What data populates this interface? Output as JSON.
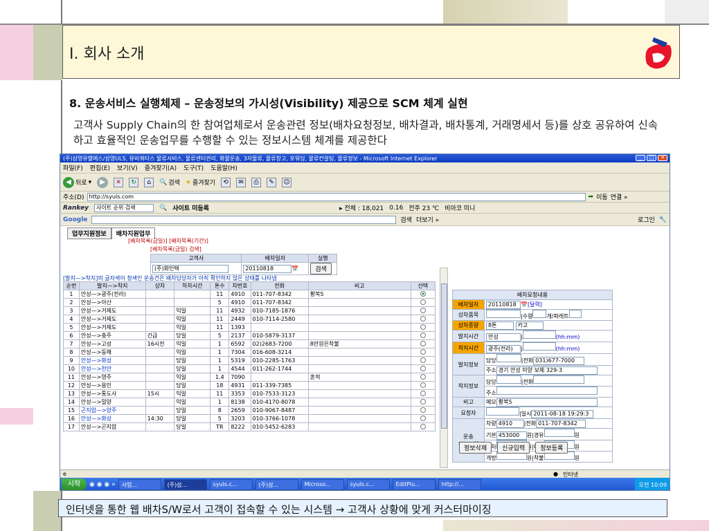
{
  "slide": {
    "title": "I. 회사 소개",
    "section_title": "8. 운송서비스 실행체제 – 운송정보의 가시성(Visibility) 제공으로 SCM 체계 실현",
    "description": "고객사 Supply Chain의 한 참여업체로서 운송관련 정보(배차요청정보, 배차결과, 배차통계, 거래명세서 등)를 상호 공유하여 신속하고 효율적인 운송업무를 수행할 수 있는 정보시스템 체계를 제공한다",
    "footer": "인터넷을 통한 웹 배차S/W로서 고객이 접속할 수 있는 시스템 → 고객사 상황에 맞게 커스터마이징"
  },
  "browser": {
    "window_title": "(주)삼영유핼에스/삼영ULS, 유비쿼터스 물류서비스, 물류센터관리, 화물운송, 3자물류, 물류창고, 포워딩, 물류컨설팅, 물류정보 - Microsoft Internet Explorer",
    "menu": [
      "파일(F)",
      "편집(E)",
      "보기(V)",
      "즐겨찾기(A)",
      "도구(T)",
      "도움말(H)"
    ],
    "toolbar": {
      "back": "뒤로",
      "search": "검색",
      "favorites": "즐겨찾기"
    },
    "address_label": "주소(D)",
    "address": "http://syuls.com",
    "go_label": "이동",
    "links_label": "연결 »",
    "rankey": {
      "brand": "Rankey",
      "site_rank": "사이트 순위 검색",
      "register": "사이트 미등록",
      "total": "▸ 전체 : 18,021",
      "rate": "0.16",
      "weather": "전주 23 ℃",
      "bio": "비아코 미니"
    },
    "google": {
      "brand": "Google",
      "search": "검색",
      "more": "더보기 »",
      "login": "로그인"
    },
    "status_internet": "인터넷"
  },
  "app": {
    "tabs": [
      "업무지원정보",
      "배차지원업무"
    ],
    "subtabs": "[배차목록(금일)]   [배차목록(기간)]",
    "search_title": "[배차목록(금일) 검색]",
    "search_headers": {
      "customer": "고객사",
      "date": "배차일자",
      "action": "실행"
    },
    "search_values": {
      "customer": "(주)화인텍",
      "date": "20110818",
      "button": "검색"
    },
    "notice": "[발지—>착지]의 글자색이 청색인 운송건은 배차담당자가 아직 확인하지 않은 상태를 나타냄",
    "list_headers": [
      "순번",
      "발지—>착지",
      "상차",
      "하차시간",
      "톤수",
      "차번호",
      "전화",
      "비고",
      "선택"
    ],
    "list_rows": [
      [
        "1",
        "안성—>광주(전라)",
        "",
        "",
        "11",
        "4910",
        "011-707-8342",
        "황복5",
        ""
      ],
      [
        "2",
        "안성—>아산",
        "",
        "",
        "5",
        "4910",
        "011-707-8342",
        "",
        ""
      ],
      [
        "3",
        "안성—>거제도",
        "",
        "익일",
        "11",
        "4932",
        "010-7185-1876",
        "",
        ""
      ],
      [
        "4",
        "안성—>거제도",
        "",
        "익일",
        "11",
        "2449",
        "010-7114-2580",
        "",
        ""
      ],
      [
        "5",
        "안성—>거제도",
        "",
        "익일",
        "11",
        "1393",
        "",
        "",
        ""
      ],
      [
        "6",
        "안성—>충주",
        "긴급",
        "당일",
        "5",
        "2137",
        "010-5879-3137",
        "",
        ""
      ],
      [
        "7",
        "안성—>고성",
        "16시전",
        "익일",
        "1",
        "6592",
        "02)2683-7200",
        "8만원은착불",
        ""
      ],
      [
        "8",
        "안성—>동해",
        "",
        "익일",
        "1",
        "7304",
        "016-608-3214",
        "",
        ""
      ],
      [
        "9",
        "안성—>화성",
        "",
        "당일",
        "1",
        "5319",
        "010-2285-1763",
        "",
        ""
      ],
      [
        "10",
        "안성—>천안",
        "",
        "당일",
        "1",
        "4544",
        "011-262-1744",
        "",
        ""
      ],
      [
        "11",
        "안성—>영주",
        "",
        "익일",
        "1.4",
        "7090",
        "",
        "혼적",
        ""
      ],
      [
        "12",
        "안성—>용인",
        "",
        "당일",
        "18",
        "4931",
        "011-339-7385",
        "",
        ""
      ],
      [
        "13",
        "안성—>통도사",
        "15시",
        "익일",
        "11",
        "3353",
        "010-7533-3123",
        "",
        ""
      ],
      [
        "14",
        "안성—>밀양",
        "",
        "익일",
        "1",
        "8138",
        "010-4170-8078",
        "",
        ""
      ],
      [
        "15",
        "곤지암—>양주",
        "",
        "당일",
        "8",
        "2659",
        "010-9067-8487",
        "",
        ""
      ],
      [
        "16",
        "안성—>화성",
        "14:30",
        "당일",
        "5",
        "3203",
        "010-3766-1078",
        "",
        ""
      ],
      [
        "17",
        "안성—>곤지암",
        "",
        "당일",
        "TR",
        "8222",
        "010-5452-6283",
        "",
        ""
      ]
    ],
    "blue_rows": [
      9,
      10,
      15,
      16
    ],
    "selected_row": 1,
    "detail": {
      "header": "배차요청내용",
      "date_label": "배차일자",
      "date_value": "20110818",
      "calendar": "[달력]",
      "goods_label": "상차품목",
      "qty_label": "수량",
      "pallet_label": "개/파레트",
      "type_label": "상차종량",
      "type_value": "8톤",
      "type_value2": "카고",
      "dep_time_label": "발지시간",
      "dep_time_value": "안성",
      "hhmm": "(hh:mm)",
      "arr_time_label": "착지시간",
      "arr_time_value": "광주(전라)",
      "dep_info_label": "발지정보",
      "manager_label": "담당",
      "tel_label": "전화",
      "dep_tel": "031)677-7000",
      "addr_label": "주소",
      "dep_addr": "경기 안성 미양 보체 329-3",
      "arr_info_label": "착지정보",
      "note_label": "비고",
      "memo_label": "메모",
      "memo_value": "황복5",
      "requester_label": "요청자",
      "datetime_label": "일시",
      "datetime_value": "2011-08-18 19:29:3",
      "car_label": "차량",
      "car_value": "4910",
      "car_tel": "011-707-8342",
      "trans_label": "운송\n정보조회",
      "base_label": "기본",
      "base_value": "453000",
      "won": "원",
      "via_label": "경유",
      "collect_label": "회차",
      "wait_label": "대기",
      "extra_label": "개방",
      "arrival_pay_label": "착불",
      "buttons": [
        "정보삭제",
        "신규입력",
        "정보등록"
      ]
    }
  },
  "taskbar": {
    "start": "시작",
    "tasks": [
      "사업...",
      "(주)삼...",
      "syuls.c...",
      "(주)삼...",
      "Microso...",
      "syuls.c...",
      "EditPlu...",
      "http://..."
    ],
    "clock": "오전 10:09"
  },
  "colors": {
    "header_bg": "#fff8d8",
    "footer_bg": "#e6f2ff",
    "accent_orange": "#f6a400"
  }
}
